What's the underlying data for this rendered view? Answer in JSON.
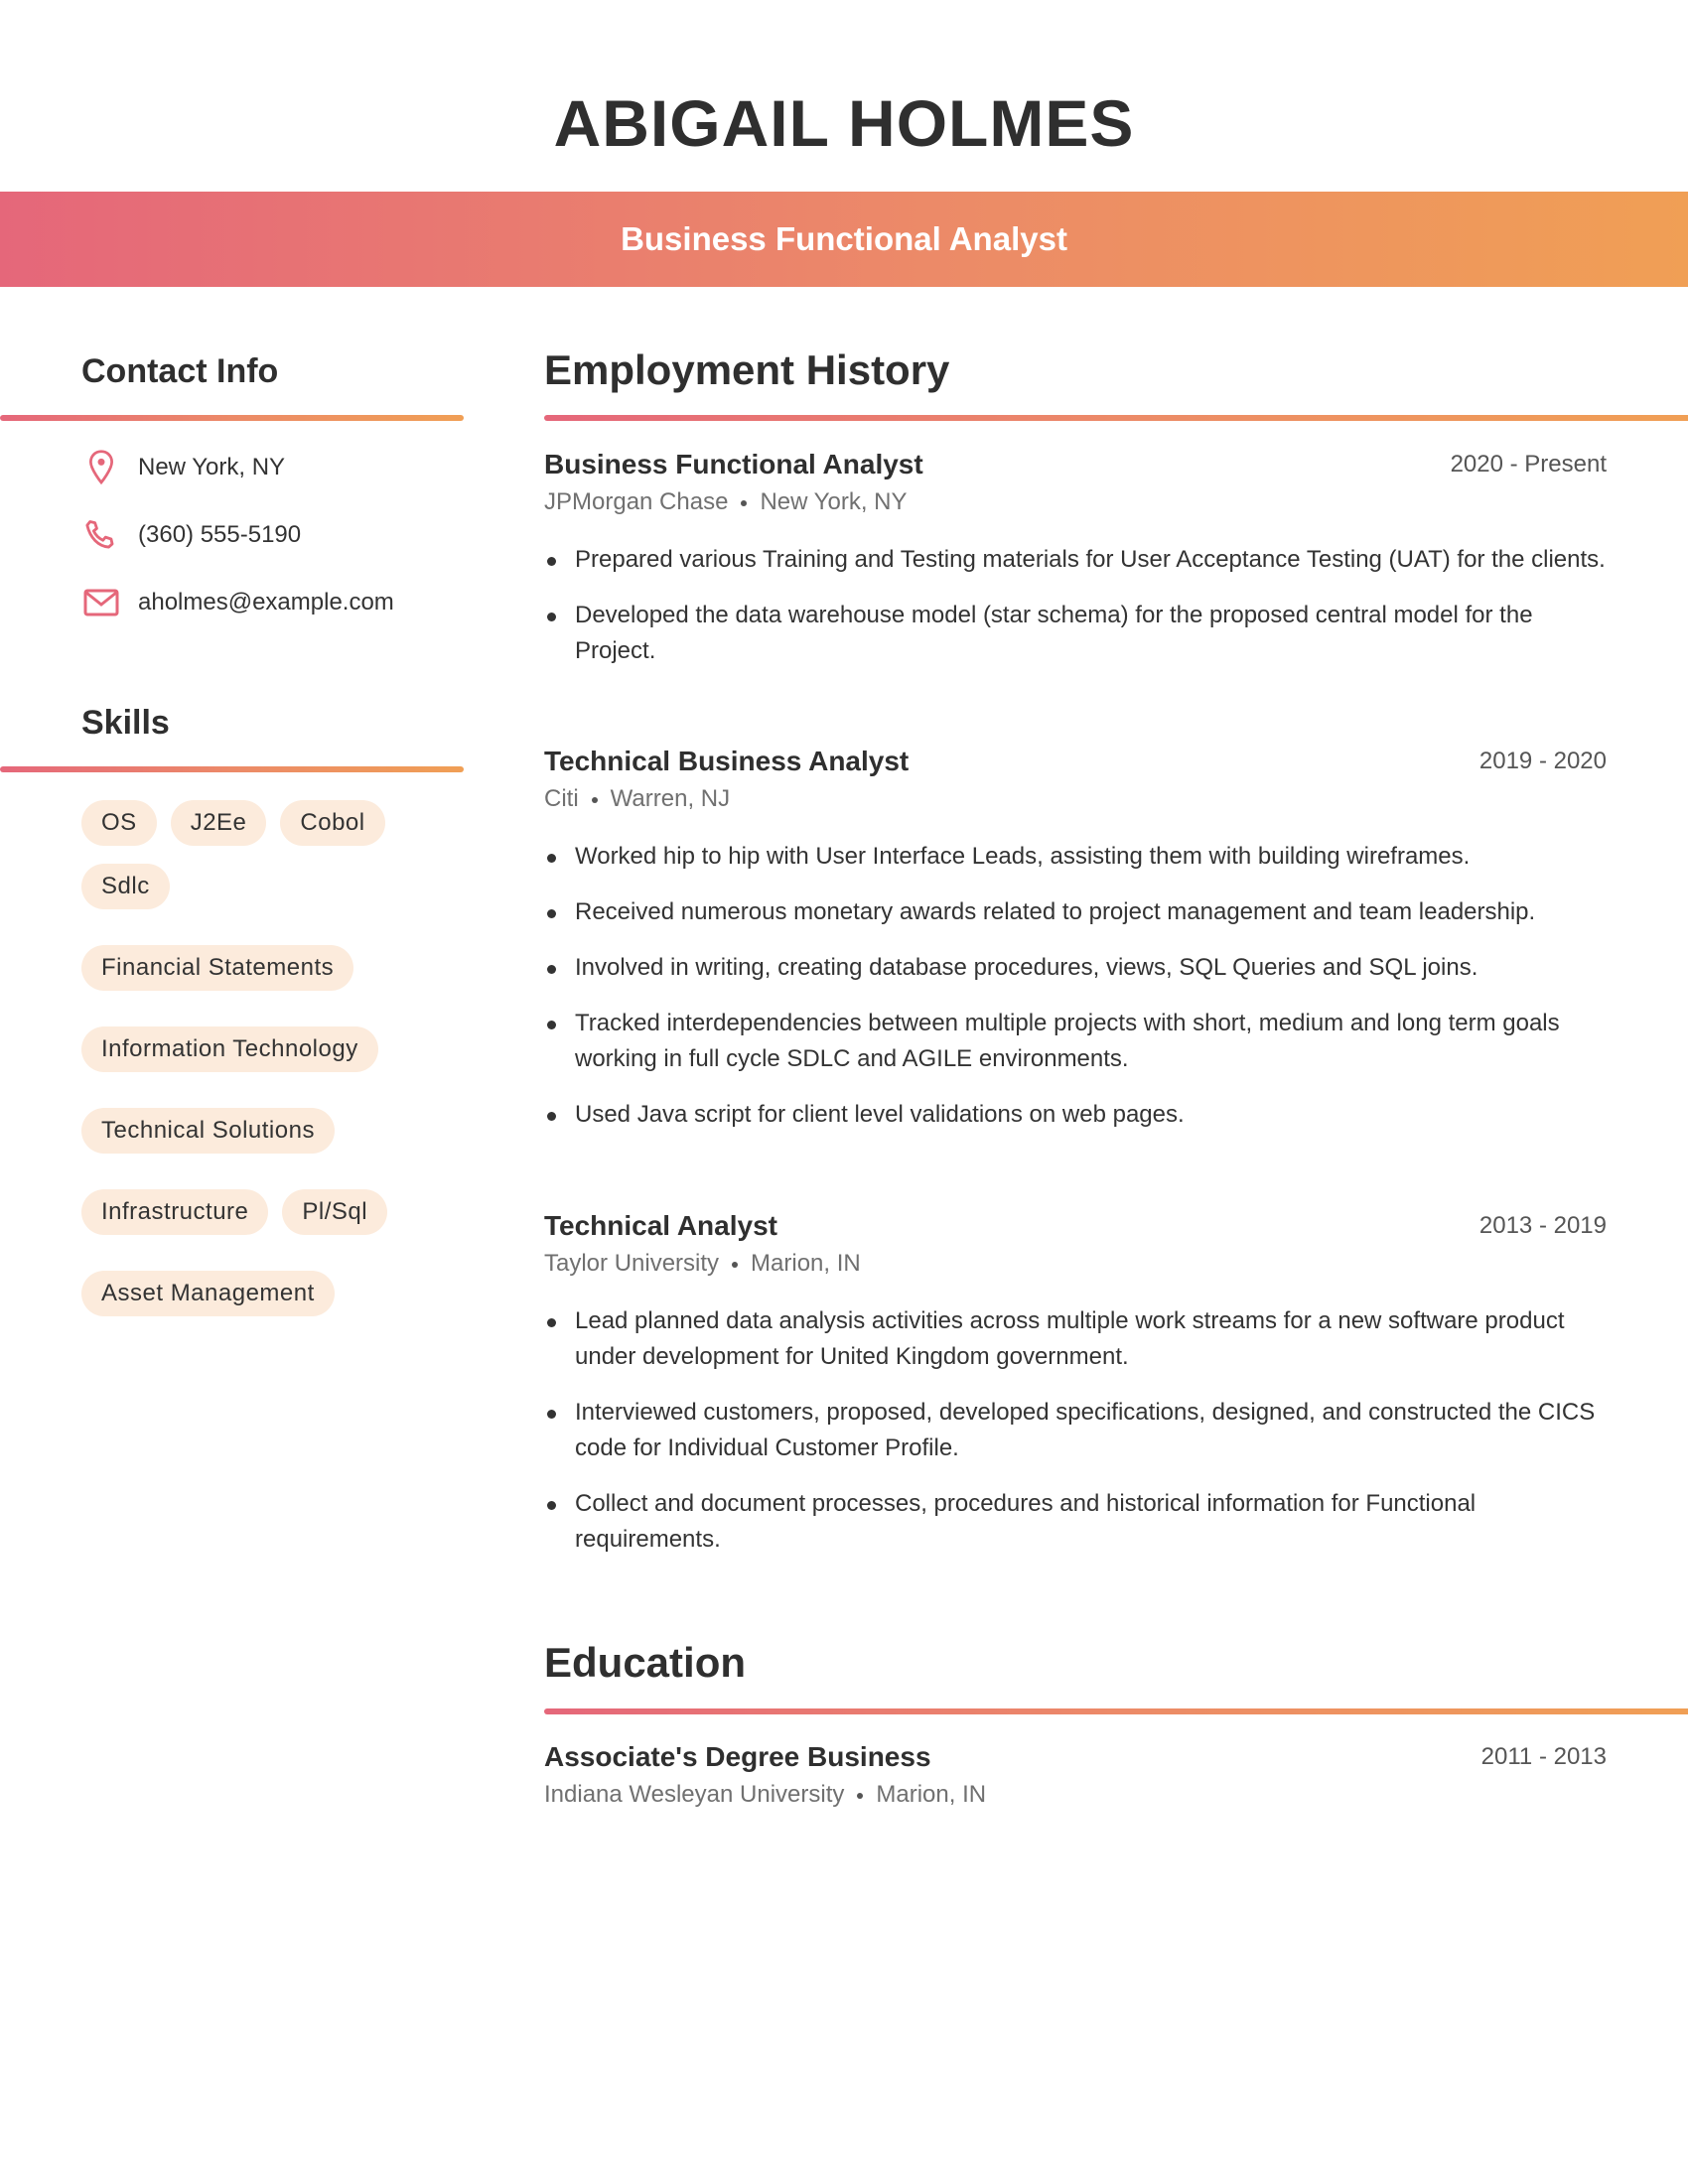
{
  "header": {
    "name": "ABIGAIL HOLMES",
    "title": "Business Functional Analyst"
  },
  "contact": {
    "heading": "Contact Info",
    "items": [
      {
        "icon": "map-pin-icon",
        "text": "New York, NY"
      },
      {
        "icon": "phone-icon",
        "text": "(360) 555-5190"
      },
      {
        "icon": "mail-icon",
        "text": "aholmes@example.com"
      }
    ]
  },
  "skills": {
    "heading": "Skills",
    "items": [
      "OS",
      "J2Ee",
      "Cobol",
      "Sdlc",
      "Financial Statements",
      "Information Technology",
      "Technical Solutions",
      "Infrastructure",
      "Pl/Sql",
      "Asset Management"
    ]
  },
  "employment": {
    "heading": "Employment History",
    "jobs": [
      {
        "title": "Business Functional Analyst",
        "dates": "2020 - Present",
        "company": "JPMorgan Chase",
        "location": "New York, NY",
        "bullets": [
          "Prepared various Training and Testing materials for User Acceptance Testing (UAT) for the clients.",
          "Developed the data warehouse model (star schema) for the proposed central model for the Project."
        ]
      },
      {
        "title": "Technical Business Analyst",
        "dates": "2019 - 2020",
        "company": "Citi",
        "location": "Warren, NJ",
        "bullets": [
          "Worked hip to hip with User Interface Leads, assisting them with building wireframes.",
          "Received numerous monetary awards related to project management and team leadership.",
          "Involved in writing, creating database procedures, views, SQL Queries and SQL joins.",
          "Tracked interdependencies between multiple projects with short, medium and long term goals working in full cycle SDLC and AGILE environments.",
          "Used Java script for client level validations on web pages."
        ]
      },
      {
        "title": "Technical Analyst",
        "dates": "2013 - 2019",
        "company": "Taylor University",
        "location": "Marion, IN",
        "bullets": [
          "Lead planned data analysis activities across multiple work streams for a new software product under development for United Kingdom government.",
          "Interviewed customers, proposed, developed specifications, designed, and constructed the CICS code for Individual Customer Profile.",
          "Collect and document processes, procedures and historical information for Functional requirements."
        ]
      }
    ]
  },
  "education": {
    "heading": "Education",
    "entries": [
      {
        "degree": "Associate's Degree Business",
        "dates": "2011 - 2013",
        "school": "Indiana Wesleyan University",
        "location": "Marion, IN"
      }
    ]
  },
  "colors": {
    "accent_start": "#e5677a",
    "accent_end": "#f09f55",
    "chip_bg": "#fcebdc",
    "text": "#2f2f2f"
  }
}
